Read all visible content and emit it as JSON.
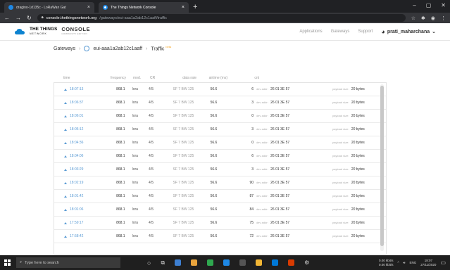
{
  "browser": {
    "tabs": [
      {
        "label": "dragino-1d135c - LoRaWan Gat",
        "active": false
      },
      {
        "label": "The Things Network Console",
        "active": true
      }
    ],
    "url_host": "console.thethingsnetwork.org",
    "url_path": "/gateways/eui-aaa1a2ab12c1aaff/traffic"
  },
  "app": {
    "brand_top": "THE THINGS",
    "brand_bottom": "NETWORK",
    "console": "CONSOLE",
    "console_sub": "COMMUNITY EDITION",
    "nav": [
      "Applications",
      "Gateways",
      "Support"
    ],
    "user": "prati_maharchana"
  },
  "breadcrumb": {
    "root": "Gateways",
    "gateway": "eui-aaa1a2ab12c1aaff",
    "page": "Traffic",
    "badge": "beta"
  },
  "table": {
    "headers": {
      "time": "time",
      "frequency": "frequency",
      "mod": "mod.",
      "cr": "CR",
      "data_rate": "data rate",
      "airtime": "airtime (ms)",
      "cnt": "cnt"
    },
    "dev_label": "dev addr:",
    "payload_label": "payload size:",
    "rows": [
      {
        "time": "18:07:13",
        "freq": "868.1",
        "mod": "lora",
        "cr": "4/5",
        "dr": "SF 7 BW 125",
        "air": "56.6",
        "cnt": "6",
        "dev": "26 01 3E 57",
        "pl": "20 bytes"
      },
      {
        "time": "18:06:37",
        "freq": "868.1",
        "mod": "lora",
        "cr": "4/5",
        "dr": "SF 7 BW 125",
        "air": "56.6",
        "cnt": "3",
        "dev": "26 01 3E 57",
        "pl": "20 bytes"
      },
      {
        "time": "18:06:01",
        "freq": "868.1",
        "mod": "lora",
        "cr": "4/5",
        "dr": "SF 7 BW 125",
        "air": "56.6",
        "cnt": "0",
        "dev": "26 01 3E 57",
        "pl": "20 bytes"
      },
      {
        "time": "18:05:12",
        "freq": "868.1",
        "mod": "lora",
        "cr": "4/5",
        "dr": "SF 7 BW 125",
        "air": "56.6",
        "cnt": "3",
        "dev": "26 01 3E 57",
        "pl": "20 bytes"
      },
      {
        "time": "18:04:36",
        "freq": "868.1",
        "mod": "lora",
        "cr": "4/5",
        "dr": "SF 7 BW 125",
        "air": "56.6",
        "cnt": "0",
        "dev": "26 01 3E 57",
        "pl": "20 bytes"
      },
      {
        "time": "18:04:06",
        "freq": "868.1",
        "mod": "lora",
        "cr": "4/5",
        "dr": "SF 7 BW 125",
        "air": "56.6",
        "cnt": "6",
        "dev": "26 01 3E 57",
        "pl": "20 bytes"
      },
      {
        "time": "18:03:29",
        "freq": "868.1",
        "mod": "lora",
        "cr": "4/5",
        "dr": "SF 7 BW 125",
        "air": "56.6",
        "cnt": "3",
        "dev": "26 01 3E 57",
        "pl": "20 bytes"
      },
      {
        "time": "18:02:19",
        "freq": "868.1",
        "mod": "lora",
        "cr": "4/5",
        "dr": "SF 7 BW 125",
        "air": "56.6",
        "cnt": "90",
        "dev": "26 01 3E 57",
        "pl": "20 bytes"
      },
      {
        "time": "18:01:42",
        "freq": "868.1",
        "mod": "lora",
        "cr": "4/5",
        "dr": "SF 7 BW 125",
        "air": "56.6",
        "cnt": "87",
        "dev": "26 01 3E 57",
        "pl": "20 bytes"
      },
      {
        "time": "18:01:06",
        "freq": "868.1",
        "mod": "lora",
        "cr": "4/5",
        "dr": "SF 7 BW 125",
        "air": "56.6",
        "cnt": "84",
        "dev": "26 01 3E 57",
        "pl": "20 bytes"
      },
      {
        "time": "17:59:17",
        "freq": "868.1",
        "mod": "lora",
        "cr": "4/5",
        "dr": "SF 7 BW 125",
        "air": "56.6",
        "cnt": "75",
        "dev": "26 01 3E 57",
        "pl": "20 bytes"
      },
      {
        "time": "17:58:42",
        "freq": "868.1",
        "mod": "lora",
        "cr": "4/5",
        "dr": "SF 7 BW 125",
        "air": "56.6",
        "cnt": "72",
        "dev": "26 01 3E 57",
        "pl": "20 bytes"
      }
    ]
  },
  "taskbar": {
    "search_placeholder": "Type here to search",
    "net_up": "0.00 kbit/s",
    "net_down": "0.00 kbit/s",
    "lang": "ENG",
    "time": "18:07",
    "date": "27/11/2020"
  }
}
